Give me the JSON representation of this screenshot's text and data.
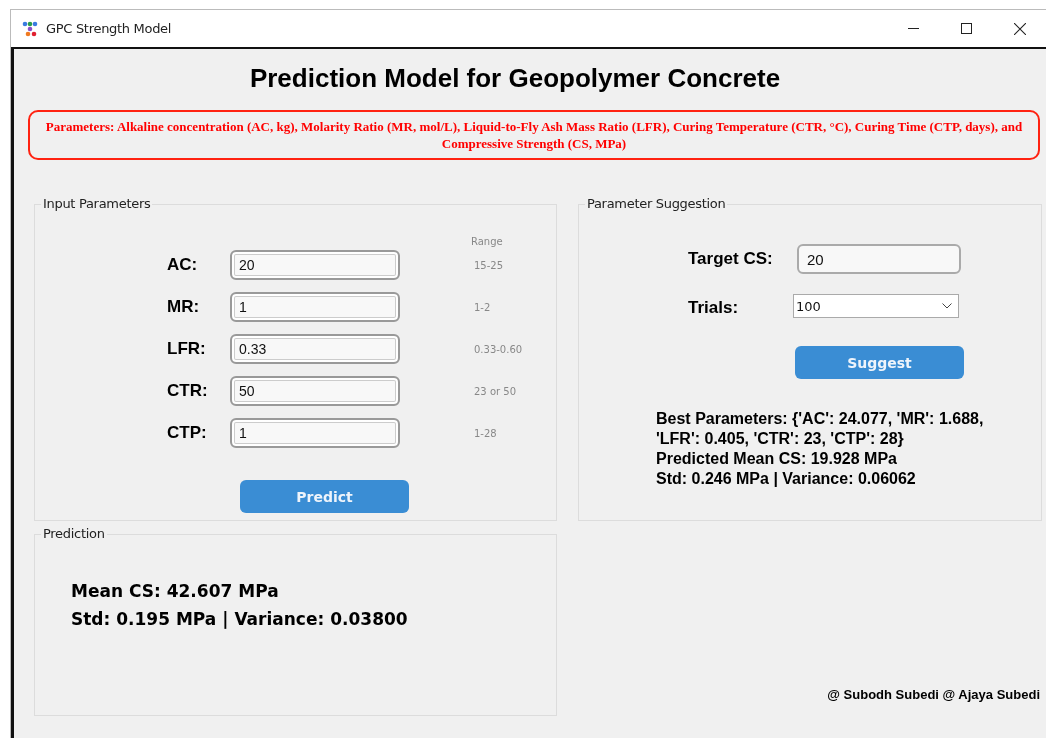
{
  "window": {
    "title": "GPC Strength Model"
  },
  "heading": "Prediction Model for Geopolymer Concrete",
  "banner": "Parameters: Alkaline concentration (AC, kg), Molarity Ratio (MR, mol/L), Liquid-to-Fly Ash Mass Ratio (LFR), Curing Temperature (CTR, °C), Curing Time (CTP, days), and Compressive Strength (CS, MPa)",
  "input_parameters": {
    "title": "Input Parameters",
    "range_header": "Range",
    "fields": [
      {
        "label": "AC:",
        "value": "20",
        "range": "15-25"
      },
      {
        "label": "MR:",
        "value": "1",
        "range": "1-2"
      },
      {
        "label": "LFR:",
        "value": "0.33",
        "range": "0.33-0.60"
      },
      {
        "label": "CTR:",
        "value": "50",
        "range": "23 or 50"
      },
      {
        "label": "CTP:",
        "value": "1",
        "range": "1-28"
      }
    ],
    "button": "Predict"
  },
  "prediction": {
    "title": "Prediction",
    "lines": [
      "Mean CS: 42.607 MPa",
      "Std: 0.195 MPa | Variance: 0.03800"
    ]
  },
  "parameter_suggestion": {
    "title": "Parameter Suggestion",
    "target_label": "Target CS:",
    "target_value": "20",
    "trials_label": "Trials:",
    "trials_value": "100",
    "button": "Suggest",
    "result": [
      "Best Parameters: {'AC': 24.077, 'MR': 1.688, 'LFR': 0.405, 'CTR': 23, 'CTP': 28}",
      "Predicted Mean CS: 19.928 MPa",
      "Std: 0.246 MPa | Variance: 0.06062"
    ]
  },
  "credit": "@ Subodh Subedi @ Ajaya Subedi"
}
